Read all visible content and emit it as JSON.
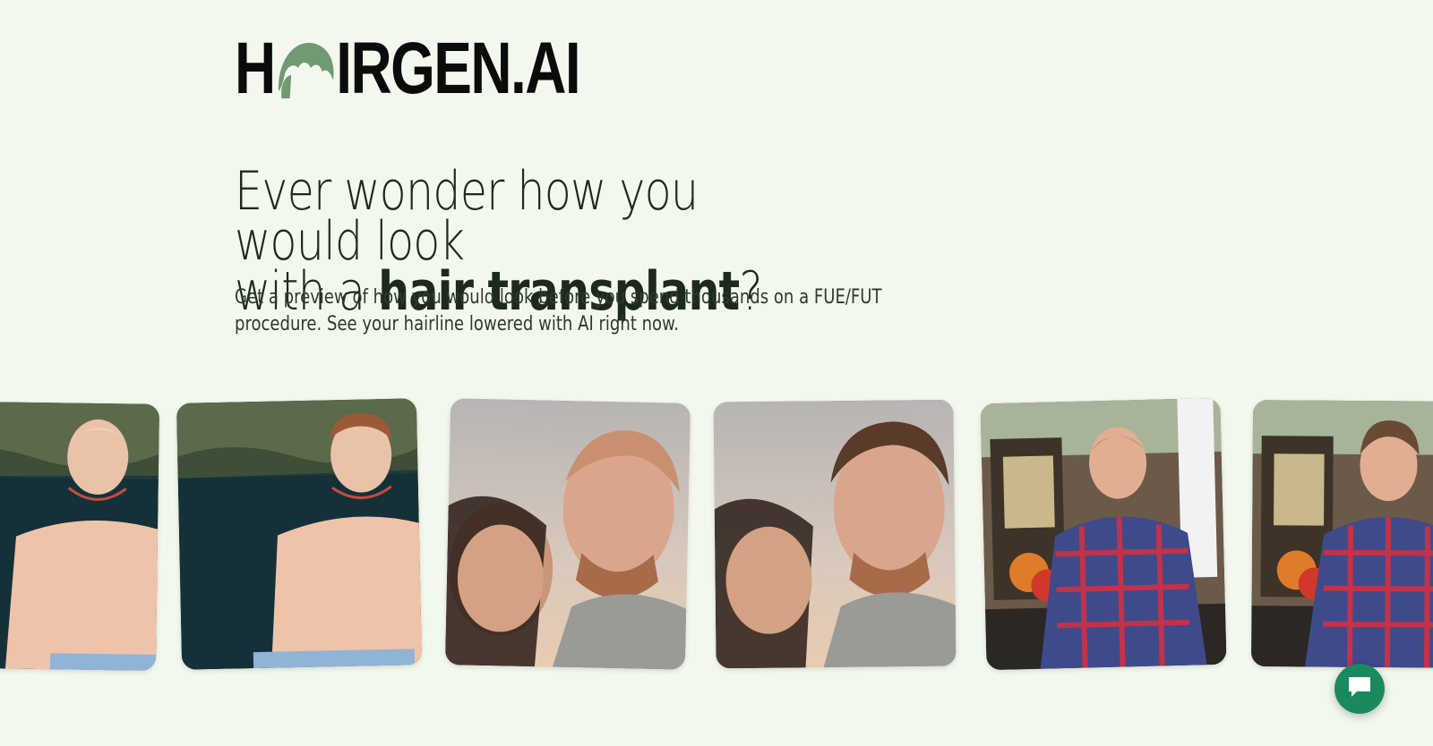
{
  "brand": {
    "logo_left": "H",
    "logo_right": "IRGEN.AI",
    "logo_hair_color": "#6f9a72"
  },
  "hero": {
    "headline_line1": "Ever wonder how you would look",
    "headline_line2_prefix": "with a ",
    "headline_bold": "hair transplant",
    "headline_suffix": "?",
    "subtext": "Get a preview of how you would look before you spend thousands on a FUE/FUT procedure. See your hairline lowered with AI right now."
  },
  "gallery": {
    "photos": [
      {
        "name": "cenote-before",
        "scene": "cenote"
      },
      {
        "name": "cenote-after",
        "scene": "cenote"
      },
      {
        "name": "sunset-selfie-before",
        "scene": "sunset"
      },
      {
        "name": "sunset-selfie-after",
        "scene": "sunset"
      },
      {
        "name": "plaid-shirt-before",
        "scene": "market"
      },
      {
        "name": "plaid-shirt-after",
        "scene": "market"
      }
    ]
  },
  "chat": {
    "icon": "chat-bubble-icon",
    "color": "#1a8a5e"
  },
  "colors": {
    "background": "#f3f8ee",
    "text": "#111111",
    "accent": "#6f9a72"
  }
}
